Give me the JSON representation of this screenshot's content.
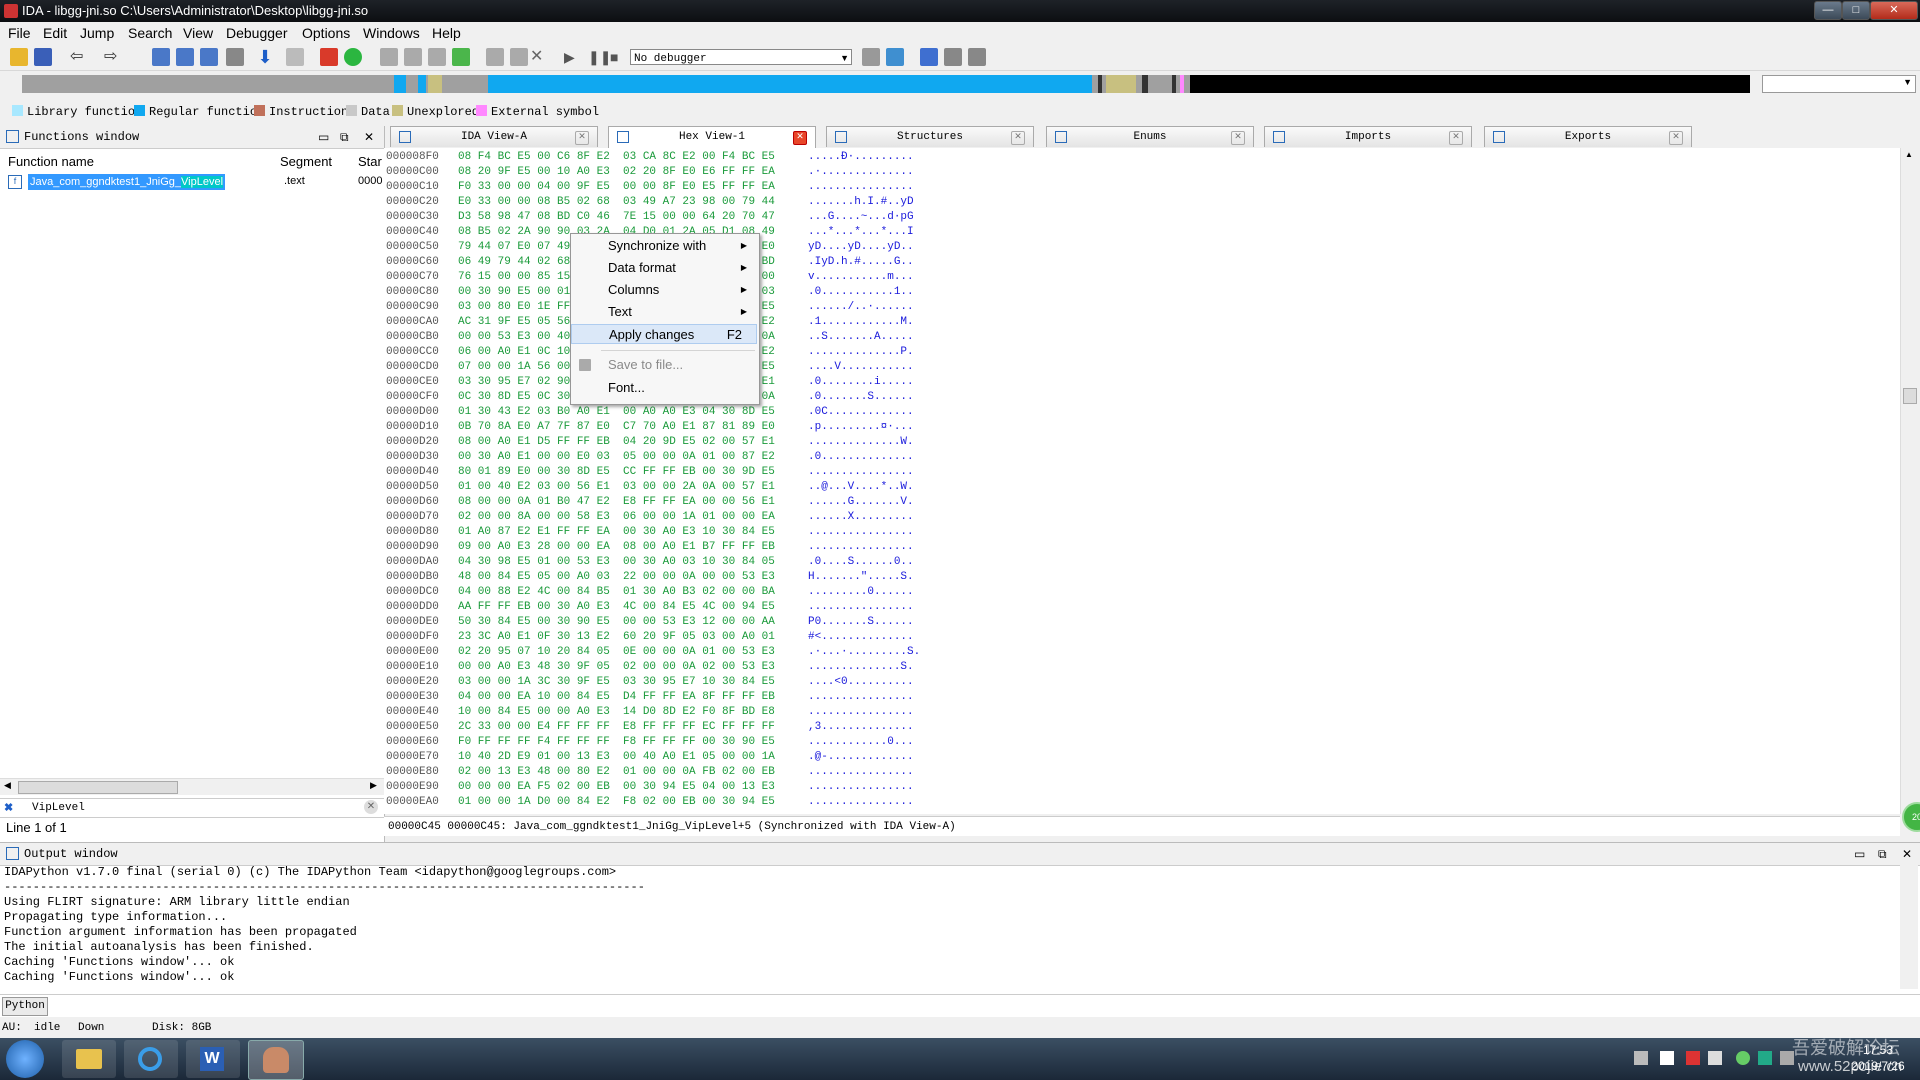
{
  "window": {
    "title": "IDA - libgg-jni.so C:\\Users\\Administrator\\Desktop\\libgg-jni.so",
    "min_label": "—",
    "max_label": "□",
    "close_label": "✕"
  },
  "menu": [
    "File",
    "Edit",
    "Jump",
    "Search",
    "View",
    "Debugger",
    "Options",
    "Windows",
    "Help"
  ],
  "toolbar": {
    "debugger_select": "No debugger"
  },
  "legend": [
    {
      "label": "Library function",
      "color": "#a8e8ff"
    },
    {
      "label": "Regular function",
      "color": "#10a8f0"
    },
    {
      "label": "Instruction",
      "color": "#c0705a"
    },
    {
      "label": "Data",
      "color": "#c8c8c8"
    },
    {
      "label": "Unexplored",
      "color": "#c8c080"
    },
    {
      "label": "External symbol",
      "color": "#ff88ff"
    }
  ],
  "functions_window": {
    "title": "Functions window",
    "columns": [
      "Function name",
      "Segment",
      "Star"
    ],
    "row": {
      "name": "Java_com_ggndktest1_JniGg_",
      "name_hl": "VipLevel",
      "segment": ".text",
      "start": "0000"
    },
    "filter_text": "VipLevel",
    "status": "Line 1 of 1"
  },
  "tabs": [
    {
      "label": "IDA View-A",
      "active": false
    },
    {
      "label": "Hex View-1",
      "active": true
    },
    {
      "label": "Structures",
      "active": false
    },
    {
      "label": "Enums",
      "active": false
    },
    {
      "label": "Imports",
      "active": false
    },
    {
      "label": "Exports",
      "active": false
    }
  ],
  "hex_rows": [
    {
      "a": "000008F0",
      "h": "08 F4 BC E5 00 C6 8F E2  03 CA 8C E2 00 F4 BC E5",
      "t": ".....Ð·........."
    },
    {
      "a": "00000C00",
      "h": "08 20 9F E5 00 10 A0 E3  02 20 8F E0 E6 FF FF EA",
      "t": ".·.............."
    },
    {
      "a": "00000C10",
      "h": "F0 33 00 00 04 00 9F E5  00 00 8F E0 E5 FF FF EA",
      "t": "................"
    },
    {
      "a": "00000C20",
      "h": "E0 33 00 00 08 B5 02 68  03 49 A7 23 98 00 79 44",
      "t": ".......h.I.#..yD"
    },
    {
      "a": "00000C30",
      "h": "D3 58 98 47 08 BD C0 46  7E 15 00 00 64 20 70 47",
      "t": "...G....~...d·pG"
    },
    {
      "a": "00000C40",
      "h": "08 B5 02 2A 90 90 03 2A  04 D0 01 2A 05 D1 08 49",
      "t": "...*...*...*...I"
    },
    {
      "a": "00000C50",
      "h": "79 44 07 E0 07 49 79 44  04 E0 07 49 79 44 01 E0",
      "t": "yD....yD....yD.."
    },
    {
      "a": "00000C60",
      "h": "06 49 79 44 02 68 A7 23  98 00 1F 58 98 47 08 BD",
      "t": ".IyD.h.#.....G.."
    },
    {
      "a": "00000C70",
      "h": "76 15 00 00 85 15 00 00  A0 1F 00 00 6D 15 00 00",
      "t": "v...........m..."
    },
    {
      "a": "00000C80",
      "h": "00 30 90 E5 00 01 90 E5  00 00 A0 E3 80 04 E3 03",
      "t": ".0...........1.."
    },
    {
      "a": "00000C90",
      "h": "03 00 80 E0 1E FF 2F E1  00 00 00 00 F8 00 9F E5",
      "t": "....../..·......"
    },
    {
      "a": "00000CA0",
      "h": "AC 31 9F E5 05 56 10 E3  00 20 8F E0 F8 4D 2D E2",
      "t": ".1............M."
    },
    {
      "a": "00000CB0",
      "h": "00 00 53 E3 00 40 A0 E1  00 41 9F E5 00 10 9D 0A",
      "t": "..S.......A....."
    },
    {
      "a": "00000CC0",
      "h": "06 00 A0 E1 0C 10 92 E5  00 00 00 00 01 50 8F E2",
      "t": "..............P."
    },
    {
      "a": "00000CD0",
      "h": "07 00 00 1A 56 00 00 EA  00 00 00 00 00 F0 9F E5",
      "t": "....V..........."
    },
    {
      "a": "00000CE0",
      "h": "03 30 95 E7 02 90 A0 E1  00 00 00 69 00 00 A0 E1",
      "t": ".0........i....."
    },
    {
      "a": "00000CF0",
      "h": "0C 30 8D E5 0C 30 9D E5  00 53 00 00 00 00 A0 0A",
      "t": ".0.......S......"
    },
    {
      "a": "00000D00",
      "h": "01 30 43 E2 03 B0 A0 E1  00 A0 A0 E3 04 30 8D E5",
      "t": ".0C............."
    },
    {
      "a": "00000D10",
      "h": "0B 70 8A E0 A7 7F 87 E0  C7 70 A0 E1 87 81 89 E0",
      "t": ".p.........¤·..."
    },
    {
      "a": "00000D20",
      "h": "08 00 A0 E1 D5 FF FF EB  04 20 9D E5 02 00 57 E1",
      "t": "..............W."
    },
    {
      "a": "00000D30",
      "h": "00 30 A0 E1 00 00 E0 03  05 00 00 0A 01 00 87 E2",
      "t": ".0.............."
    },
    {
      "a": "00000D40",
      "h": "80 01 89 E0 00 30 8D E5  CC FF FF EB 00 30 9D E5",
      "t": "................"
    },
    {
      "a": "00000D50",
      "h": "01 00 40 E2 03 00 56 E1  03 00 00 2A 0A 00 57 E1",
      "t": "..@...V....*..W."
    },
    {
      "a": "00000D60",
      "h": "08 00 00 0A 01 B0 47 E2  E8 FF FF EA 00 00 56 E1",
      "t": "......G.......V."
    },
    {
      "a": "00000D70",
      "h": "02 00 00 8A 00 00 58 E3  06 00 00 1A 01 00 00 EA",
      "t": "......X........."
    },
    {
      "a": "00000D80",
      "h": "01 A0 87 E2 E1 FF FF EA  00 30 A0 E3 10 30 84 E5",
      "t": "................"
    },
    {
      "a": "00000D90",
      "h": "09 00 A0 E3 28 00 00 EA  08 00 A0 E1 B7 FF FF EB",
      "t": "................"
    },
    {
      "a": "00000DA0",
      "h": "04 30 98 E5 01 00 53 E3  00 30 A0 03 10 30 84 05",
      "t": ".0....S......0.."
    },
    {
      "a": "00000DB0",
      "h": "48 00 84 E5 05 00 A0 03  22 00 00 0A 00 00 53 E3",
      "t": "H.......\".....S."
    },
    {
      "a": "00000DC0",
      "h": "04 00 88 E2 4C 00 84 B5  01 30 A0 B3 02 00 00 BA",
      "t": ".........0......"
    },
    {
      "a": "00000DD0",
      "h": "AA FF FF EB 00 30 A0 E3  4C 00 84 E5 4C 00 94 E5",
      "t": "................"
    },
    {
      "a": "00000DE0",
      "h": "50 30 84 E5 00 30 90 E5  00 00 53 E3 12 00 00 AA",
      "t": "P0.......S......"
    },
    {
      "a": "00000DF0",
      "h": "23 3C A0 E1 0F 30 13 E2  60 20 9F 05 03 00 A0 01",
      "t": "#<.............."
    },
    {
      "a": "00000E00",
      "h": "02 20 95 07 10 20 84 05  0E 00 00 0A 01 00 53 E3",
      "t": ".·...·.........S."
    },
    {
      "a": "00000E10",
      "h": "00 00 A0 E3 48 30 9F 05  02 00 00 0A 02 00 53 E3",
      "t": "..............S."
    },
    {
      "a": "00000E20",
      "h": "03 00 00 1A 3C 30 9F E5  03 30 95 E7 10 30 84 E5",
      "t": "....<0.........."
    },
    {
      "a": "00000E30",
      "h": "04 00 00 EA 10 00 84 E5  D4 FF FF EA 8F FF FF EB",
      "t": "................"
    },
    {
      "a": "00000E40",
      "h": "10 00 84 E5 00 00 A0 E3  14 D0 8D E2 F0 8F BD E8",
      "t": "................"
    },
    {
      "a": "00000E50",
      "h": "2C 33 00 00 E4 FF FF FF  E8 FF FF FF EC FF FF FF",
      "t": ",3.............."
    },
    {
      "a": "00000E60",
      "h": "F0 FF FF FF F4 FF FF FF  F8 FF FF FF 00 30 90 E5",
      "t": "............0..."
    },
    {
      "a": "00000E70",
      "h": "10 40 2D E9 01 00 13 E3  00 40 A0 E1 05 00 00 1A",
      "t": ".@-............."
    },
    {
      "a": "00000E80",
      "h": "02 00 13 E3 48 00 80 E2  01 00 00 0A FB 02 00 EB",
      "t": "................"
    },
    {
      "a": "00000E90",
      "h": "00 00 00 EA F5 02 00 EB  00 30 94 E5 04 00 13 E3",
      "t": "................"
    },
    {
      "a": "00000EA0",
      "h": "01 00 00 1A D0 00 84 E2  F8 02 00 EB 00 30 94 E5",
      "t": "................"
    }
  ],
  "hex_status": "00000C45 00000C45: Java_com_ggndktest1_JniGg_VipLevel+5  (Synchronized with IDA View-A)",
  "context_menu": [
    {
      "label": "Synchronize with",
      "submenu": true,
      "shortcut": "",
      "disabled": false
    },
    {
      "label": "Data format",
      "submenu": true,
      "shortcut": "",
      "disabled": false
    },
    {
      "label": "Columns",
      "submenu": true,
      "shortcut": "",
      "disabled": false
    },
    {
      "label": "Text",
      "submenu": true,
      "shortcut": "",
      "disabled": false
    },
    {
      "label": "Apply changes",
      "submenu": false,
      "shortcut": "F2",
      "disabled": false
    },
    {
      "label": "Save to file...",
      "submenu": false,
      "shortcut": "",
      "disabled": true
    },
    {
      "label": "Font...",
      "submenu": false,
      "shortcut": "",
      "disabled": false
    }
  ],
  "output_window": {
    "title": "Output window",
    "lines": [
      "IDAPython v1.7.0 final (serial 0) (c) The IDAPython Team <idapython@googlegroups.com>",
      "-----------------------------------------------------------------------------------------",
      "Using FLIRT signature: ARM library little endian",
      "Propagating type information...",
      "Function argument information has been propagated",
      "The initial autoanalysis has been finished.",
      "Caching 'Functions window'... ok",
      "Caching 'Functions window'... ok"
    ]
  },
  "python_button": "Python",
  "statusbar": {
    "au_label": "AU:",
    "au_value": "idle",
    "dir": "Down",
    "disk": "Disk: 8GB"
  },
  "taskbar": {
    "watermark1": "吾爱破解论坛",
    "watermark2": "www.52pojie.cn",
    "time": "17:53",
    "date": "2019/7/26"
  }
}
